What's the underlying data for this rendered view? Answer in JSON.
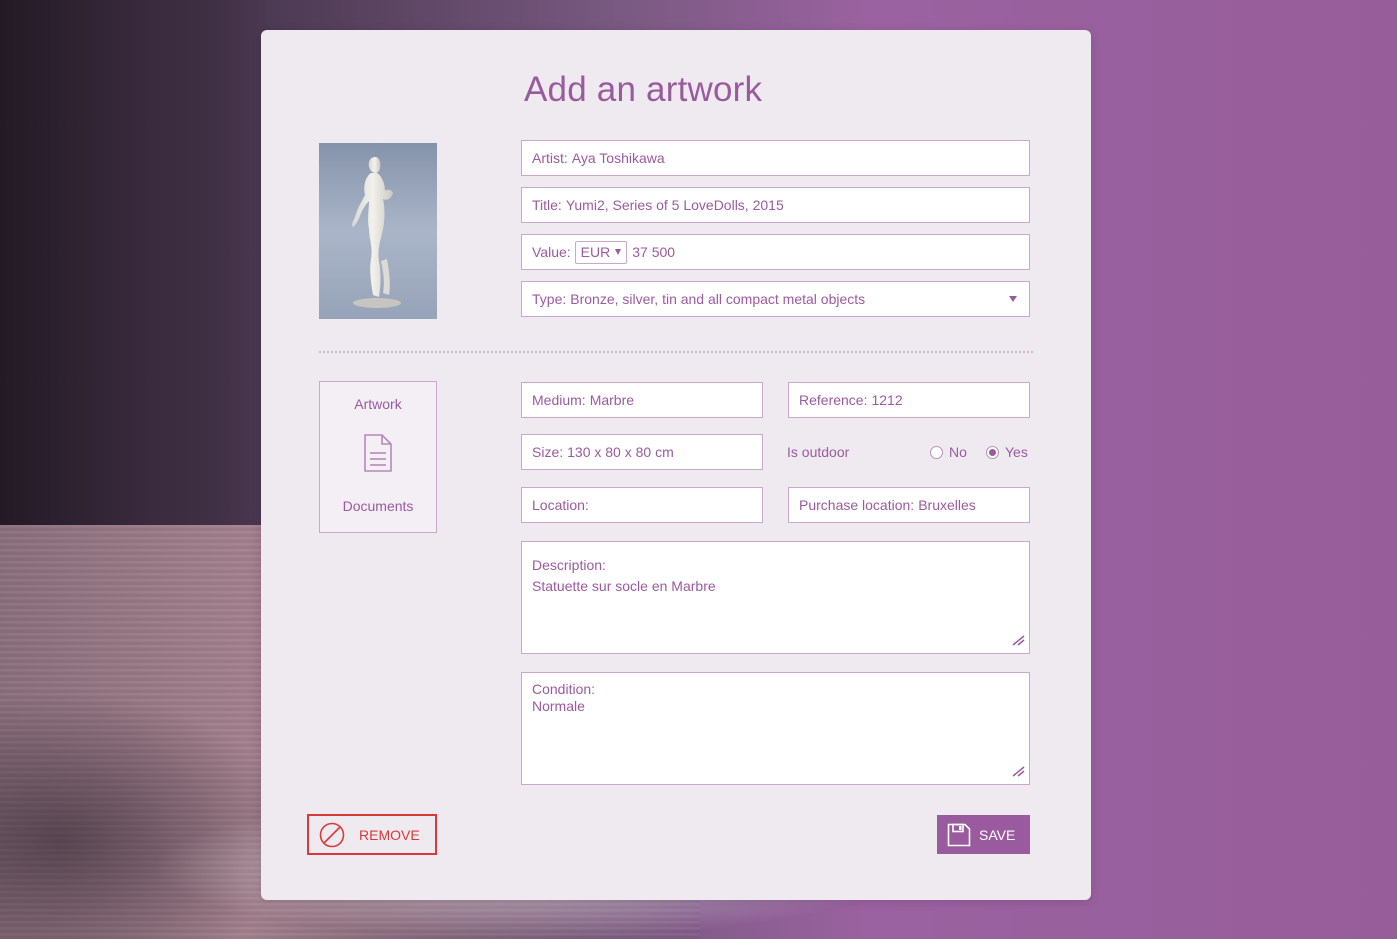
{
  "page": {
    "title": "Add an artwork"
  },
  "fields": {
    "artist": {
      "label": "Artist:",
      "value": "Aya Toshikawa"
    },
    "title": {
      "label": "Title:",
      "value": "Yumi2, Series of 5 LoveDolls, 2015"
    },
    "value": {
      "label": "Value:",
      "currency": "EUR",
      "amount": "37 500"
    },
    "type": {
      "label": "Type:",
      "value": "Bronze, silver, tin and all compact metal objects"
    },
    "medium": {
      "label": "Medium:",
      "value": "Marbre"
    },
    "reference": {
      "label": "Reference:",
      "value": "1212"
    },
    "size": {
      "label": "Size:",
      "value": "130 x 80 x 80 cm"
    },
    "outdoor": {
      "label": "Is outdoor",
      "options": [
        "No",
        "Yes"
      ],
      "selected": "Yes"
    },
    "location": {
      "label": "Location:",
      "value": ""
    },
    "purchase_location": {
      "label": "Purchase location:",
      "value": "Bruxelles"
    },
    "description": {
      "label": "Description:",
      "value": "Statuette sur socle en Marbre"
    },
    "condition": {
      "label": "Condition:",
      "value": "Normale"
    }
  },
  "documents_card": {
    "top_label": "Artwork",
    "bottom_label": "Documents",
    "icon": "document-icon"
  },
  "actions": {
    "remove_label": "REMOVE",
    "remove_icon": "prohibited-icon",
    "save_label": "SAVE",
    "save_icon": "floppy-disk-icon"
  },
  "colors": {
    "accent": "#9a5b9e",
    "danger": "#d83a3a",
    "card_bg": "#efeaf0",
    "field_border": "#c9a8cc"
  }
}
